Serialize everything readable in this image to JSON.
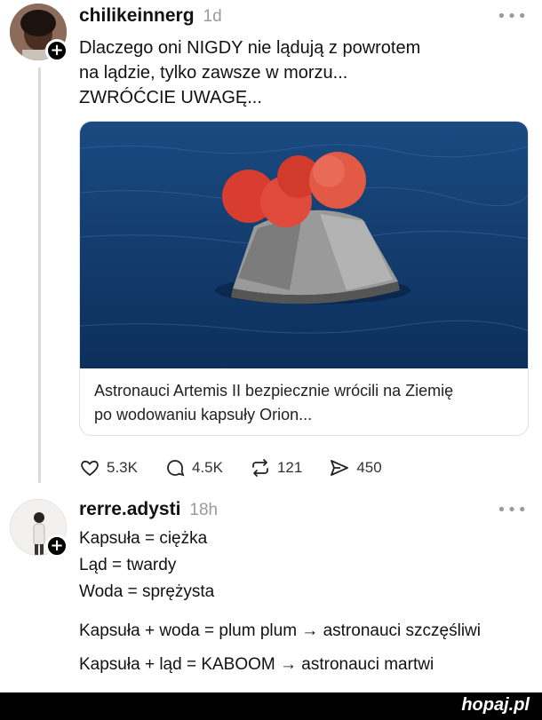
{
  "post1": {
    "username": "chilikeinnerg",
    "time": "1d",
    "text": "Dlaczego oni NIGDY nie lądują z powrotem\nna lądzie, tylko zawsze w morzu...\nZWRÓĆCIE UWAGĘ...",
    "card_caption": "Astronauci Artemis II bezpiecznie wrócili na Ziemię\npo wodowaniu kapsuły Orion...",
    "likes": "5.3K",
    "replies": "4.5K",
    "reposts": "121",
    "shares": "450"
  },
  "post2": {
    "username": "rerre.adysti",
    "time": "18h",
    "lines": [
      "Kapsuła = ciężka",
      "Ląd = twardy",
      "Woda = sprężysta",
      "Kapsuła + woda = plum plum → astronauci szczęśliwi",
      "Kapsuła + ląd = KABOOM → astronauci martwi"
    ]
  },
  "more_label": "•••",
  "plus_label": "+",
  "brand": "hopaj.pl",
  "colors": {
    "sea": "#123f72",
    "parachute": "#e24a3b",
    "capsule": "#8f8f8f",
    "brand_bar": "#000000"
  },
  "icons": [
    "heart-icon",
    "comment-icon",
    "repost-icon",
    "share-icon",
    "more-icon"
  ]
}
